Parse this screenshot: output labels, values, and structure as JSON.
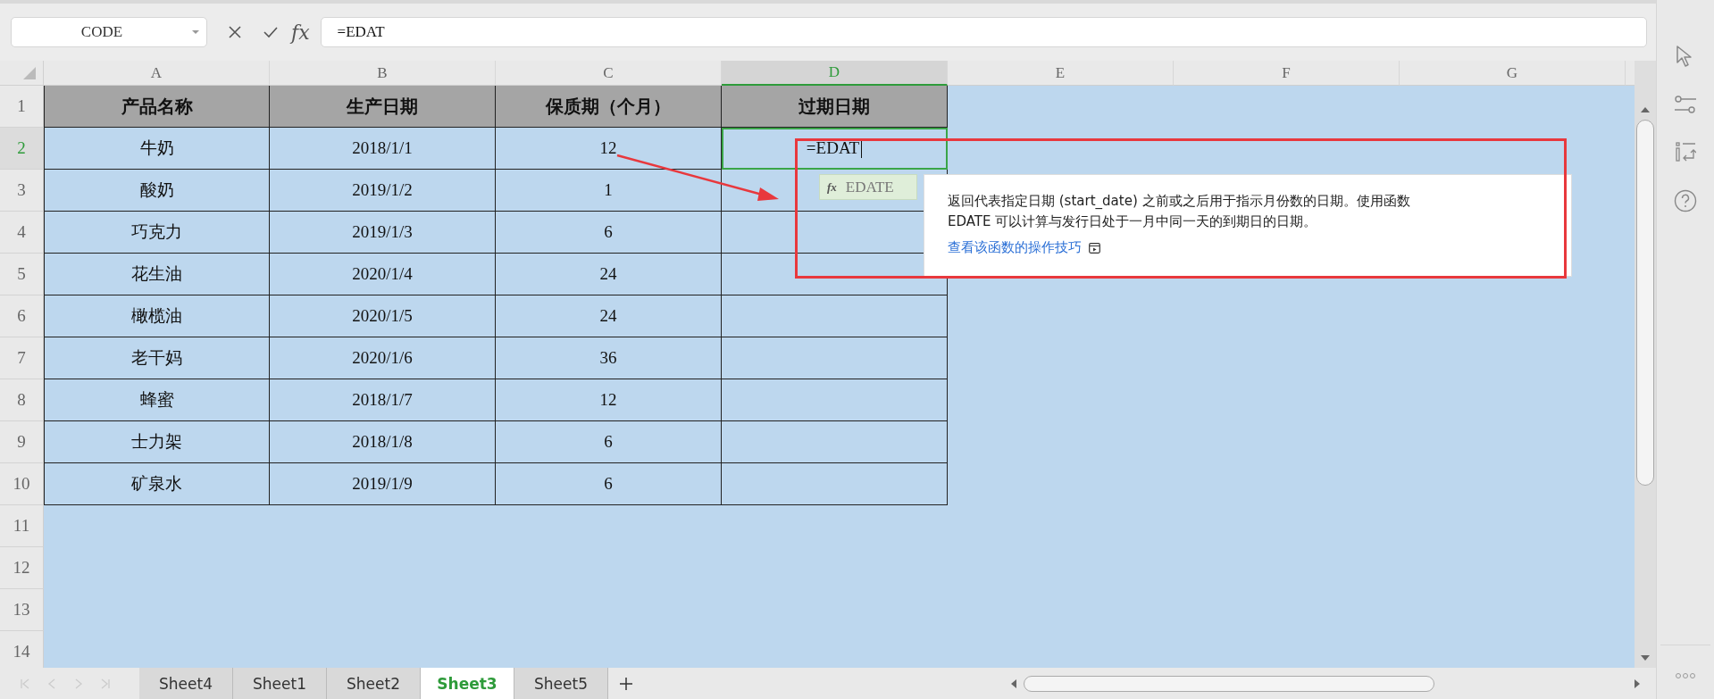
{
  "formula_bar": {
    "name_box": "CODE",
    "fx": "fx",
    "formula": "=EDAT"
  },
  "columns": [
    {
      "label": "A",
      "selected": false
    },
    {
      "label": "B",
      "selected": false
    },
    {
      "label": "C",
      "selected": false
    },
    {
      "label": "D",
      "selected": true
    },
    {
      "label": "E",
      "selected": false
    },
    {
      "label": "F",
      "selected": false
    },
    {
      "label": "G",
      "selected": false
    }
  ],
  "row_numbers": [
    {
      "label": "1",
      "selected": false
    },
    {
      "label": "2",
      "selected": true
    },
    {
      "label": "3",
      "selected": false
    },
    {
      "label": "4",
      "selected": false
    },
    {
      "label": "5",
      "selected": false
    },
    {
      "label": "6",
      "selected": false
    },
    {
      "label": "7",
      "selected": false
    },
    {
      "label": "8",
      "selected": false
    },
    {
      "label": "9",
      "selected": false
    },
    {
      "label": "10",
      "selected": false
    },
    {
      "label": "11",
      "selected": false
    },
    {
      "label": "12",
      "selected": false
    },
    {
      "label": "13",
      "selected": false
    },
    {
      "label": "14",
      "selected": false
    }
  ],
  "table": {
    "header": [
      "产品名称",
      "生产日期",
      "保质期（个月）",
      "过期日期"
    ],
    "rows": [
      [
        "牛奶",
        "2018/1/1",
        "12"
      ],
      [
        "酸奶",
        "2019/1/2",
        "1"
      ],
      [
        "巧克力",
        "2019/1/3",
        "6"
      ],
      [
        "花生油",
        "2020/1/4",
        "24"
      ],
      [
        "橄榄油",
        "2020/1/5",
        "24"
      ],
      [
        "老干妈",
        "2020/1/6",
        "36"
      ],
      [
        "蜂蜜",
        "2018/1/7",
        "12"
      ],
      [
        "士力架",
        "2018/1/8",
        "6"
      ],
      [
        "矿泉水",
        "2019/1/9",
        "6"
      ]
    ]
  },
  "active_cell": {
    "value": "=EDAT"
  },
  "autocomplete": {
    "fx": "fx",
    "suggestion": "EDATE"
  },
  "tooltip": {
    "description": "返回代表指定日期 (start_date) 之前或之后用于指示月份数的日期。使用函数 EDATE 可以计算与发行日处于一月中同一天的到期日的日期。",
    "link": "查看该函数的操作技巧"
  },
  "sheet_tabs": [
    {
      "label": "Sheet4",
      "selected": false
    },
    {
      "label": "Sheet1",
      "selected": false
    },
    {
      "label": "Sheet2",
      "selected": false
    },
    {
      "label": "Sheet3",
      "selected": true
    },
    {
      "label": "Sheet5",
      "selected": false
    }
  ]
}
